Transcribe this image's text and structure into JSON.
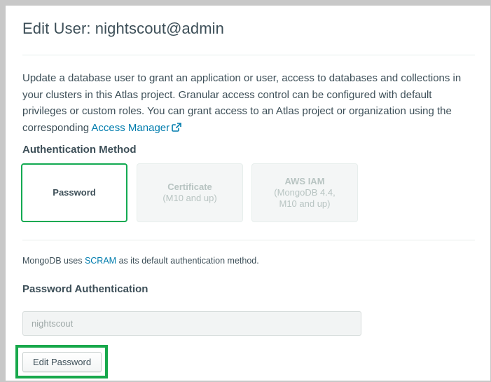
{
  "modal": {
    "title": "Edit User: nightscout@admin",
    "description_text": "Update a database user to grant an application or user, access to databases and collections in your clusters in this Atlas project. Granular access control can be configured with default privileges or custom roles. You can grant access to an Atlas project or organization using the corresponding ",
    "access_manager_link": "Access Manager",
    "close_icon": "close-icon"
  },
  "auth_method": {
    "label": "Authentication Method",
    "options": [
      {
        "title": "Password",
        "subtitle": "",
        "state": "selected"
      },
      {
        "title": "Certificate",
        "subtitle": "(M10 and up)",
        "state": "disabled"
      },
      {
        "title": "AWS IAM",
        "subtitle": "(MongoDB 4.4, M10 and up)",
        "state": "disabled"
      }
    ]
  },
  "scram_note": {
    "prefix": "MongoDB uses ",
    "link": "SCRAM",
    "suffix": " as its default authentication method."
  },
  "password_auth": {
    "label": "Password Authentication",
    "username_value": "nightscout",
    "edit_password_label": "Edit Password"
  },
  "colors": {
    "selected_border": "#13aa52",
    "highlight_border": "#17a84b",
    "link": "#007cad",
    "text": "#3d4f58"
  },
  "icons": {
    "external_link": "external-link-icon"
  }
}
